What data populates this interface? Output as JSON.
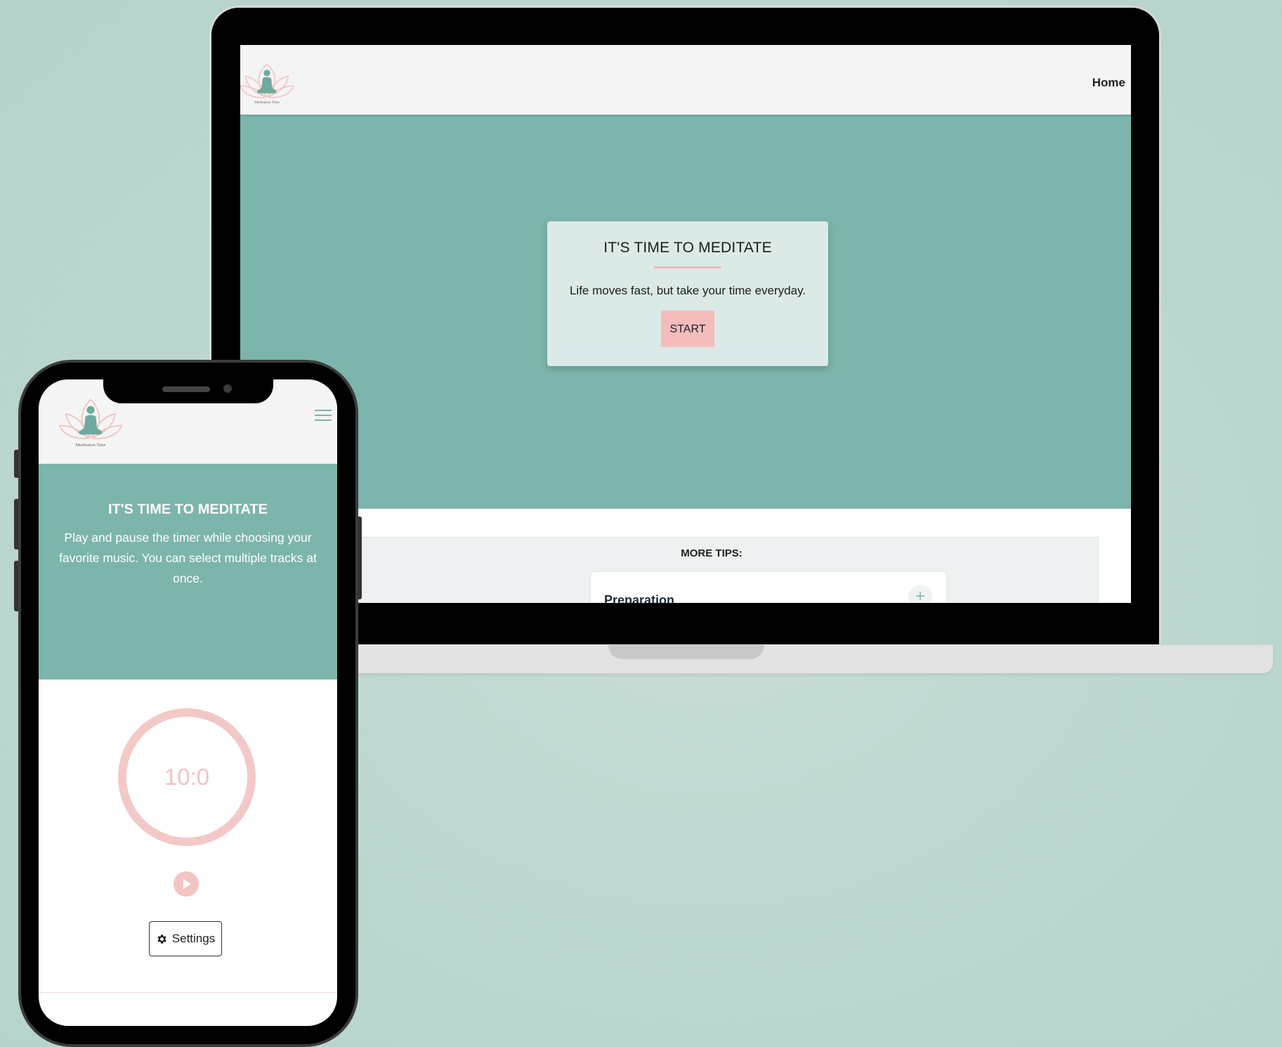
{
  "colors": {
    "teal": "#7cb5ab",
    "pink": "#f4bcbb",
    "card_bg": "#dbeae7",
    "nav_bg": "#f4f4f4"
  },
  "desktop": {
    "nav": {
      "logo_icon": "lotus-meditation-logo",
      "logo_text": "Meditation Time",
      "home_label": "Home"
    },
    "hero_card": {
      "title": "IT'S TIME TO MEDITATE",
      "text": "Life moves fast, but take your time everyday.",
      "start_label": "START"
    },
    "tips": {
      "title": "MORE TIPS:",
      "items": [
        {
          "label": "Preparation",
          "expand_icon": "plus-icon"
        }
      ]
    }
  },
  "mobile": {
    "nav": {
      "logo_icon": "lotus-meditation-logo",
      "logo_text": "Meditation Time",
      "menu_icon": "hamburger-menu-icon"
    },
    "hero": {
      "title": "IT'S TIME TO MEDITATE",
      "text": "Play and pause the timer while choosing your favorite music. You can select multiple tracks at once."
    },
    "timer": {
      "value": "10:0",
      "play_icon": "play-icon"
    },
    "settings": {
      "label": "Settings",
      "icon": "gear-icon"
    }
  }
}
